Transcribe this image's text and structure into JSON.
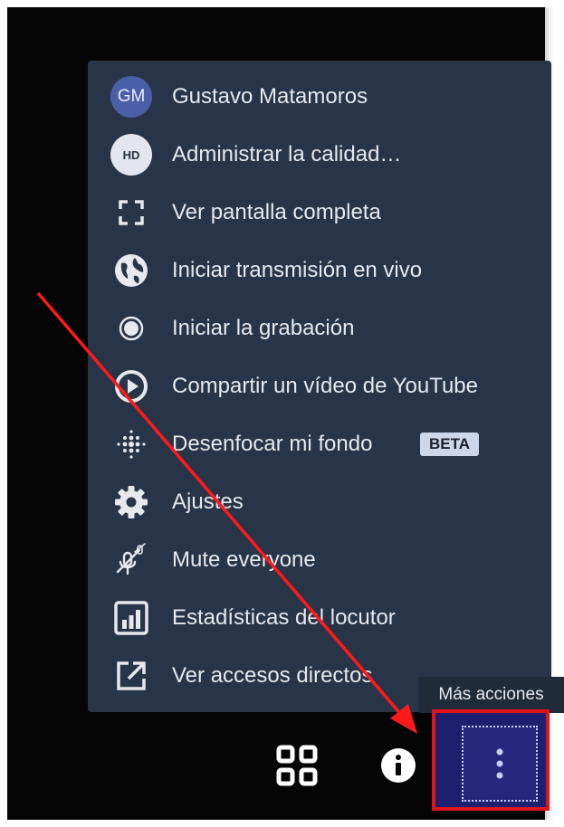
{
  "menu": {
    "items": [
      {
        "label": "Gustavo Matamoros",
        "icon": "avatar",
        "avatar_initials": "GM"
      },
      {
        "label": "Administrar la calidad…",
        "icon": "hd-quality-icon",
        "badge_text": "HD"
      },
      {
        "label": "Ver pantalla completa",
        "icon": "fullscreen-icon"
      },
      {
        "label": "Iniciar transmisión en vivo",
        "icon": "globe-icon"
      },
      {
        "label": "Iniciar la grabación",
        "icon": "record-icon"
      },
      {
        "label": "Compartir un vídeo de YouTube",
        "icon": "play-circle-icon"
      },
      {
        "label": "Desenfocar mi fondo",
        "icon": "blur-dots-icon",
        "tag": "BETA"
      },
      {
        "label": "Ajustes",
        "icon": "gear-icon"
      },
      {
        "label": "Mute everyone",
        "icon": "mic-muted-icon"
      },
      {
        "label": "Estadísticas del locutor",
        "icon": "stats-chart-icon"
      },
      {
        "label": "Ver accesos directos",
        "icon": "external-link-icon"
      }
    ]
  },
  "tooltip": {
    "text": "Más acciones"
  },
  "toolbar": {
    "tile_view_icon": "tile-view-icon",
    "info_icon": "info-icon",
    "more_actions_icon": "vertical-dots-icon"
  },
  "colors": {
    "menu_bg": "#283447",
    "highlight_border": "#e0141b",
    "arrow": "#ff1a1a",
    "more_button_bg": "#26277c"
  }
}
